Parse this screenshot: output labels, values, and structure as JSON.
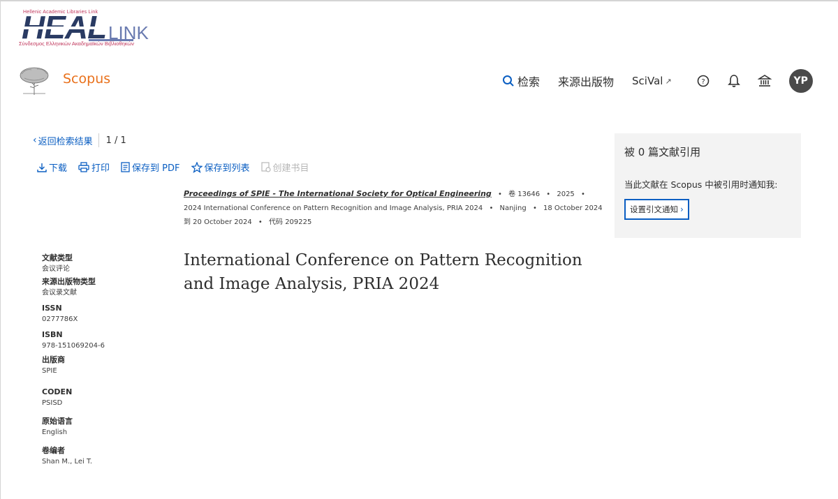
{
  "heal_logo": {
    "top_text": "Hellenic Academic Libraries Link",
    "main": "HEAL",
    "link": "LINK",
    "subtitle": "Σύνδεσμος Ελληνικών Ακαδημαϊκών Βιβλιοθηκών"
  },
  "header": {
    "brand": "Scopus",
    "nav": {
      "search": "检索",
      "sources": "来源出版物",
      "scival": "SciVal"
    },
    "avatar": "YP"
  },
  "back_row": {
    "back_label": "返回检索结果",
    "pager": "1 / 1"
  },
  "actions": {
    "download": "下载",
    "print": "打印",
    "save_pdf": "保存到 PDF",
    "save_list": "保存到列表",
    "create_bib": "创建书目"
  },
  "source": {
    "title": "Proceedings of SPIE - The International Society for Optical Engineering",
    "volume": "卷 13646",
    "year": "2025",
    "conference": "2024 International Conference on Pattern Recognition and Image Analysis, PRIA 2024",
    "location": "Nanjing",
    "dates": "18 October 2024到 20 October 2024",
    "code": "代码 209225"
  },
  "document": {
    "title": "International Conference on Pattern Recognition and Image Analysis, PRIA 2024"
  },
  "metadata": [
    {
      "label": "文献类型",
      "value": "会议评论"
    },
    {
      "label": "来源出版物类型",
      "value": "会议录文献"
    },
    {
      "label": "ISSN",
      "value": "0277786X"
    },
    {
      "label": "ISBN",
      "value": "978-151069204-6"
    },
    {
      "label": "出版商",
      "value": "SPIE"
    },
    {
      "label": "CODEN",
      "value": "PSISD"
    },
    {
      "label": "原始语言",
      "value": "English"
    },
    {
      "label": "卷编者",
      "value": "Shan M., Lei T."
    }
  ],
  "cite_panel": {
    "title": "被 0 篇文献引用",
    "text": "当此文献在 Scopus 中被引用时通知我:",
    "button": "设置引文通知"
  },
  "colors": {
    "accent": "#0a5ec2",
    "brand": "#e9711c",
    "panel": "#f3f3f3"
  }
}
